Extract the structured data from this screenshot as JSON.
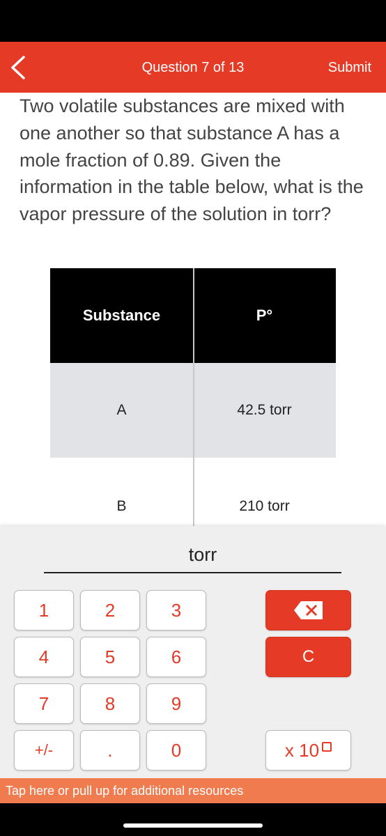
{
  "header": {
    "title": "Question 7 of 13",
    "submit": "Submit",
    "back_icon": "chevron-left-icon"
  },
  "question": "Two volatile substances are mixed with one another so that substance A has a mole fraction of 0.89. Given the information in the table below, what is the vapor pressure of the solution in torr?",
  "table": {
    "headers": [
      "Substance",
      "P°"
    ],
    "rows": [
      [
        "A",
        "42.5 torr"
      ],
      [
        "B",
        "210 torr"
      ]
    ]
  },
  "answer": {
    "value": "",
    "unit": "torr"
  },
  "keypad": {
    "keys": [
      "1",
      "2",
      "3",
      "4",
      "5",
      "6",
      "7",
      "8",
      "9",
      "+/-",
      ".",
      "0"
    ],
    "backspace_icon": "backspace-icon",
    "clear": "C",
    "exponent": "x 10"
  },
  "resources": "Tap here or pull up for additional resources",
  "colors": {
    "accent": "#e53a26",
    "resources_bar": "#f07b4e"
  }
}
